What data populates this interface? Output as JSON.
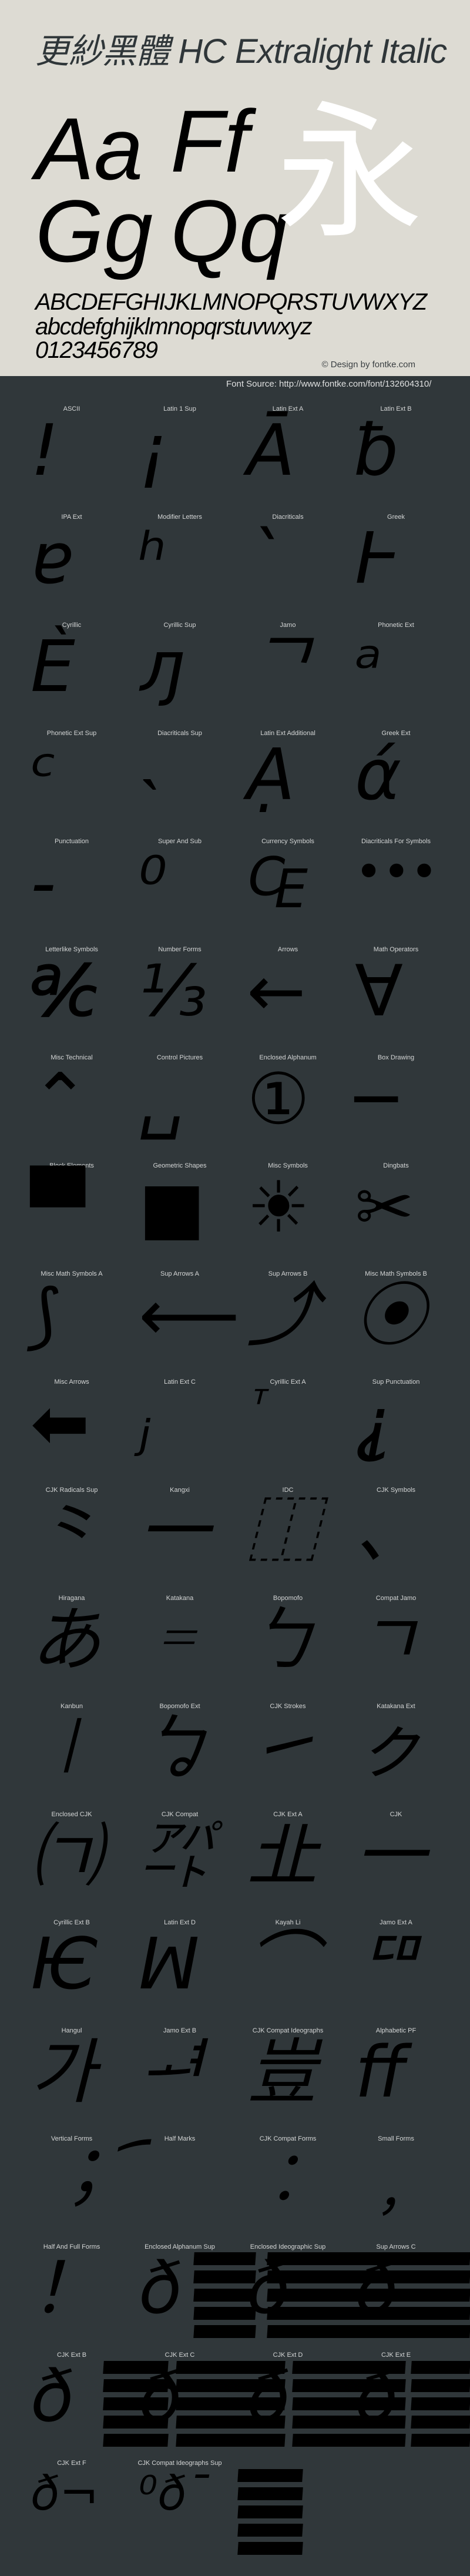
{
  "header": {
    "title": "更紗黑體 HC Extralight Italic",
    "sample_pairs": [
      "Aa",
      "Ff",
      "Gg",
      "Qq"
    ],
    "sample_cjk": "永",
    "uppercase": "ABCDEFGHIJKLMNOPQRSTUVWXYZ",
    "lowercase": "abcdefghijklmnopqrstuvwxyz",
    "digits": "0123456789",
    "credit": "© Design by fontke.com",
    "background": "#dddbd3"
  },
  "source": "Font Source: http://www.fontke.com/font/132604310/",
  "grid_background": "#30373a",
  "blocks": [
    {
      "label": "ASCII",
      "glyph": "!"
    },
    {
      "label": "Latin 1 Sup",
      "glyph": "¡"
    },
    {
      "label": "Latin Ext A",
      "glyph": "Ā"
    },
    {
      "label": "Latin Ext B",
      "glyph": "ƀ"
    },
    {
      "label": "IPA Ext",
      "glyph": "ɐ"
    },
    {
      "label": "Modifier Letters",
      "glyph": "ʰ"
    },
    {
      "label": "Diacriticals",
      "glyph": "ˋ"
    },
    {
      "label": "Greek",
      "glyph": "Ͱ"
    },
    {
      "label": "Cyrillic",
      "glyph": "Ѐ"
    },
    {
      "label": "Cyrillic Sup",
      "glyph": "ԓ"
    },
    {
      "label": "Jamo",
      "glyph": "ᄀ"
    },
    {
      "label": "Phonetic Ext",
      "glyph": "ᵃ"
    },
    {
      "label": "Phonetic Ext Sup",
      "glyph": "ᶜ"
    },
    {
      "label": "Diacriticals Sup",
      "glyph": "˴"
    },
    {
      "label": "Latin Ext Additional",
      "glyph": "Ạ"
    },
    {
      "label": "Greek Ext",
      "glyph": "ά"
    },
    {
      "label": "Punctuation",
      "glyph": "‐"
    },
    {
      "label": "Super And Sub",
      "glyph": "⁰"
    },
    {
      "label": "Currency Symbols",
      "glyph": "₠"
    },
    {
      "label": "Diacriticals For Symbols",
      "glyph": "•••"
    },
    {
      "label": "Letterlike Symbols",
      "glyph": "℀"
    },
    {
      "label": "Number Forms",
      "glyph": "⅓"
    },
    {
      "label": "Arrows",
      "glyph": "←"
    },
    {
      "label": "Math Operators",
      "glyph": "∀"
    },
    {
      "label": "Misc Technical",
      "glyph": "⌃"
    },
    {
      "label": "Control Pictures",
      "glyph": "␣"
    },
    {
      "label": "Enclosed Alphanum",
      "glyph": "①"
    },
    {
      "label": "Box Drawing",
      "glyph": "─"
    },
    {
      "label": "Block Elements",
      "glyph": "▀"
    },
    {
      "label": "Geometric Shapes",
      "glyph": "■"
    },
    {
      "label": "Misc Symbols",
      "glyph": "☀"
    },
    {
      "label": "Dingbats",
      "glyph": "✂"
    },
    {
      "label": "Misc Math Symbols A",
      "glyph": "⟆"
    },
    {
      "label": "Sup Arrows A",
      "glyph": "⟵"
    },
    {
      "label": "Sup Arrows B",
      "glyph": "⤴"
    },
    {
      "label": "Misc Math Symbols B",
      "glyph": "⦿"
    },
    {
      "label": "Misc Arrows",
      "glyph": "⬅"
    },
    {
      "label": "Latin Ext C",
      "glyph": "ⱼ"
    },
    {
      "label": "Cyrillic Ext A",
      "glyph": "ⷮ"
    },
    {
      "label": "Sup Punctuation",
      "glyph": "⸘"
    },
    {
      "label": "CJK Radicals Sup",
      "glyph": "⺀"
    },
    {
      "label": "Kangxi",
      "glyph": "⼀"
    },
    {
      "label": "IDC",
      "glyph": "⿰"
    },
    {
      "label": "CJK Symbols",
      "glyph": "、"
    },
    {
      "label": "Hiragana",
      "glyph": "あ"
    },
    {
      "label": "Katakana",
      "glyph": "゠"
    },
    {
      "label": "Bopomofo",
      "glyph": "ㄅ"
    },
    {
      "label": "Compat Jamo",
      "glyph": "ㄱ"
    },
    {
      "label": "Kanbun",
      "glyph": "㆐"
    },
    {
      "label": "Bopomofo Ext",
      "glyph": "ㆠ"
    },
    {
      "label": "CJK Strokes",
      "glyph": "㇀"
    },
    {
      "label": "Katakana Ext",
      "glyph": "ㇰ"
    },
    {
      "label": "Enclosed CJK",
      "glyph": "㈀"
    },
    {
      "label": "CJK Compat",
      "glyph": "㌀"
    },
    {
      "label": "CJK Ext A",
      "glyph": "㐀"
    },
    {
      "label": "CJK",
      "glyph": "一"
    },
    {
      "label": "Cyrillic Ext B",
      "glyph": "Ѥ"
    },
    {
      "label": "Latin Ext D",
      "glyph": "ꟽ"
    },
    {
      "label": "Kayah Li",
      "glyph": "⌒"
    },
    {
      "label": "Jamo Ext A",
      "glyph": "ꥠ"
    },
    {
      "label": "Hangul",
      "glyph": "가"
    },
    {
      "label": "Jamo Ext B",
      "glyph": "ힰ"
    },
    {
      "label": "CJK Compat Ideographs",
      "glyph": "豈"
    },
    {
      "label": "Alphabetic PF",
      "glyph": "ﬀ"
    },
    {
      "label": "Vertical Forms",
      "glyph": "︔"
    },
    {
      "label": "Half Marks",
      "glyph": "︠"
    },
    {
      "label": "CJK Compat Forms",
      "glyph": "︰"
    },
    {
      "label": "Small Forms",
      "glyph": "﹐"
    },
    {
      "label": "Half And Full Forms",
      "glyph": "！"
    },
    {
      "label": "Enclosed Alphanum Sup",
      "glyph": "ð"
    },
    {
      "label": "Enclosed Ideographic Sup",
      "glyph": "ð"
    },
    {
      "label": "Sup Arrows C",
      "glyph": "ð"
    },
    {
      "label": "CJK Ext B",
      "glyph": "ð"
    },
    {
      "label": "CJK Ext C",
      "glyph": "ð"
    },
    {
      "label": "CJK Ext D",
      "glyph": "ð"
    },
    {
      "label": "CJK Ext E",
      "glyph": "ð"
    },
    {
      "label": "CJK Ext F",
      "glyph": "ð¬"
    },
    {
      "label": "CJK Compat Ideographs Sup",
      "glyph": "⁰ð¯"
    }
  ]
}
